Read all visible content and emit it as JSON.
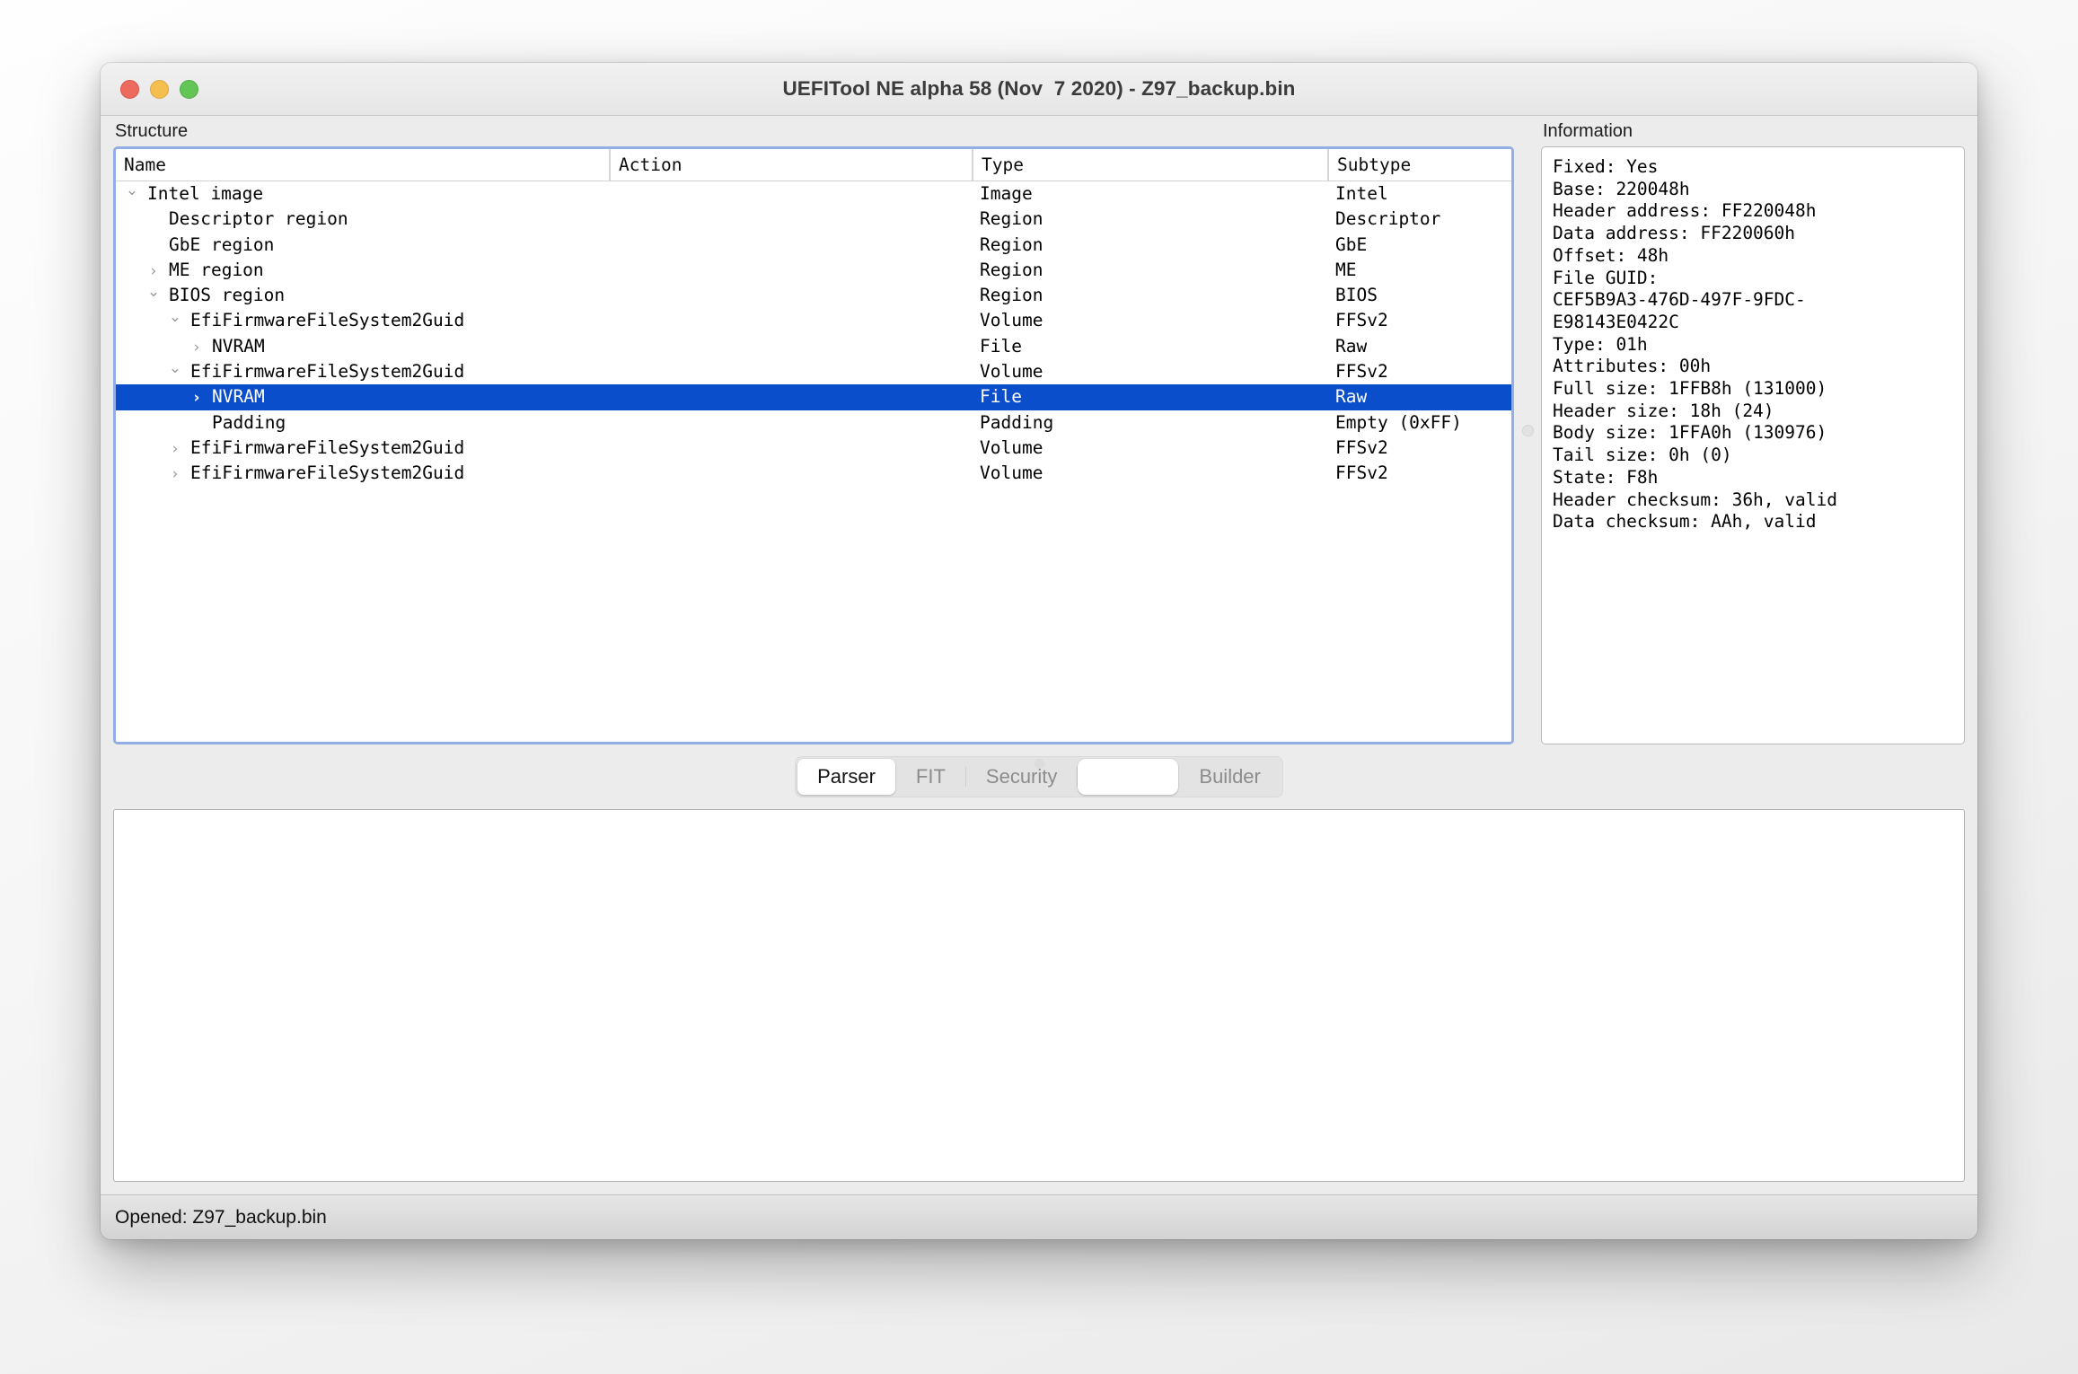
{
  "window": {
    "title": "UEFITool NE alpha 58 (Nov  7 2020) - Z97_backup.bin",
    "traffic_lights": [
      "close",
      "minimize",
      "zoom"
    ]
  },
  "structure": {
    "label": "Structure",
    "columns": [
      "Name",
      "Action",
      "Type",
      "Subtype"
    ],
    "rows": [
      {
        "name": "Intel image",
        "depth": 0,
        "chevron": "expanded",
        "action": "",
        "type": "Image",
        "subtype": "Intel",
        "selected": false
      },
      {
        "name": "Descriptor region",
        "depth": 1,
        "chevron": "none",
        "action": "",
        "type": "Region",
        "subtype": "Descriptor",
        "selected": false
      },
      {
        "name": "GbE region",
        "depth": 1,
        "chevron": "none",
        "action": "",
        "type": "Region",
        "subtype": "GbE",
        "selected": false
      },
      {
        "name": "ME region",
        "depth": 1,
        "chevron": "collapsed",
        "action": "",
        "type": "Region",
        "subtype": "ME",
        "selected": false
      },
      {
        "name": "BIOS region",
        "depth": 1,
        "chevron": "expanded",
        "action": "",
        "type": "Region",
        "subtype": "BIOS",
        "selected": false
      },
      {
        "name": "EfiFirmwareFileSystem2Guid",
        "depth": 2,
        "chevron": "expanded",
        "action": "",
        "type": "Volume",
        "subtype": "FFSv2",
        "selected": false
      },
      {
        "name": "NVRAM",
        "depth": 3,
        "chevron": "collapsed",
        "action": "",
        "type": "File",
        "subtype": "Raw",
        "selected": false
      },
      {
        "name": "EfiFirmwareFileSystem2Guid",
        "depth": 2,
        "chevron": "expanded",
        "action": "",
        "type": "Volume",
        "subtype": "FFSv2",
        "selected": false
      },
      {
        "name": "NVRAM",
        "depth": 3,
        "chevron": "collapsed",
        "action": "",
        "type": "File",
        "subtype": "Raw",
        "selected": true
      },
      {
        "name": "Padding",
        "depth": 3,
        "chevron": "none",
        "action": "",
        "type": "Padding",
        "subtype": "Empty (0xFF)",
        "selected": false
      },
      {
        "name": "EfiFirmwareFileSystem2Guid",
        "depth": 2,
        "chevron": "collapsed",
        "action": "",
        "type": "Volume",
        "subtype": "FFSv2",
        "selected": false
      },
      {
        "name": "EfiFirmwareFileSystem2Guid",
        "depth": 2,
        "chevron": "collapsed",
        "action": "",
        "type": "Volume",
        "subtype": "FFSv2",
        "selected": false
      }
    ]
  },
  "information": {
    "label": "Information",
    "lines": [
      "Fixed: Yes",
      "Base: 220048h",
      "Header address: FF220048h",
      "Data address: FF220060h",
      "Offset: 48h",
      "File GUID:",
      "CEF5B9A3-476D-497F-9FDC-",
      "E98143E0422C",
      "Type: 01h",
      "Attributes: 00h",
      "Full size: 1FFB8h (131000)",
      "Header size: 18h (24)",
      "Body size: 1FFA0h (130976)",
      "Tail size: 0h (0)",
      "State: F8h",
      "Header checksum: 36h, valid",
      "Data checksum: AAh, valid"
    ]
  },
  "tabs": [
    {
      "label": "Parser",
      "active": true,
      "blank": false
    },
    {
      "label": "FIT",
      "active": false,
      "blank": false
    },
    {
      "label": "Security",
      "active": false,
      "blank": false
    },
    {
      "label": "",
      "active": false,
      "blank": true
    },
    {
      "label": "Builder",
      "active": false,
      "blank": false
    }
  ],
  "messages": {
    "lines": []
  },
  "statusbar": {
    "text": "Opened: Z97_backup.bin"
  },
  "colors": {
    "selection_blue": "#0b4ecb",
    "focus_ring": "#93aee4",
    "window_chrome": "#ececec",
    "traffic_red": "#ed6a5e",
    "traffic_yellow": "#f5bf4f",
    "traffic_green": "#62c555"
  }
}
